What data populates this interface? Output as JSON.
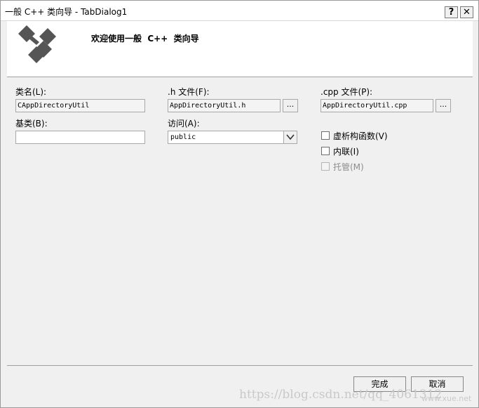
{
  "window": {
    "title": "一般 C++ 类向导 - TabDialog1",
    "help_button": "?",
    "close_button": "✕"
  },
  "header": {
    "welcome": "欢迎使用一般  C++  类向导",
    "logo_icon": "class-wizard-logo-icon"
  },
  "form": {
    "class_name_label": "类名(L):",
    "class_name_value": "CAppDirectoryUtil",
    "h_file_label": ".h 文件(F):",
    "h_file_value": "AppDirectoryUtil.h",
    "h_browse": "...",
    "cpp_file_label": ".cpp 文件(P):",
    "cpp_file_value": "AppDirectoryUtil.cpp",
    "cpp_browse": "...",
    "base_class_label": "基类(B):",
    "base_class_value": "",
    "access_label": "访问(A):",
    "access_value": "public",
    "options": [
      {
        "label": "虚析构函数(V)",
        "checked": false,
        "enabled": true
      },
      {
        "label": "内联(I)",
        "checked": false,
        "enabled": true
      },
      {
        "label": "托管(M)",
        "checked": false,
        "enabled": false
      }
    ]
  },
  "footer": {
    "finish": "完成",
    "cancel": "取消"
  },
  "watermark": {
    "url": "https://blog.csdn.net/qq_4061312",
    "site": "www.xue.net"
  }
}
